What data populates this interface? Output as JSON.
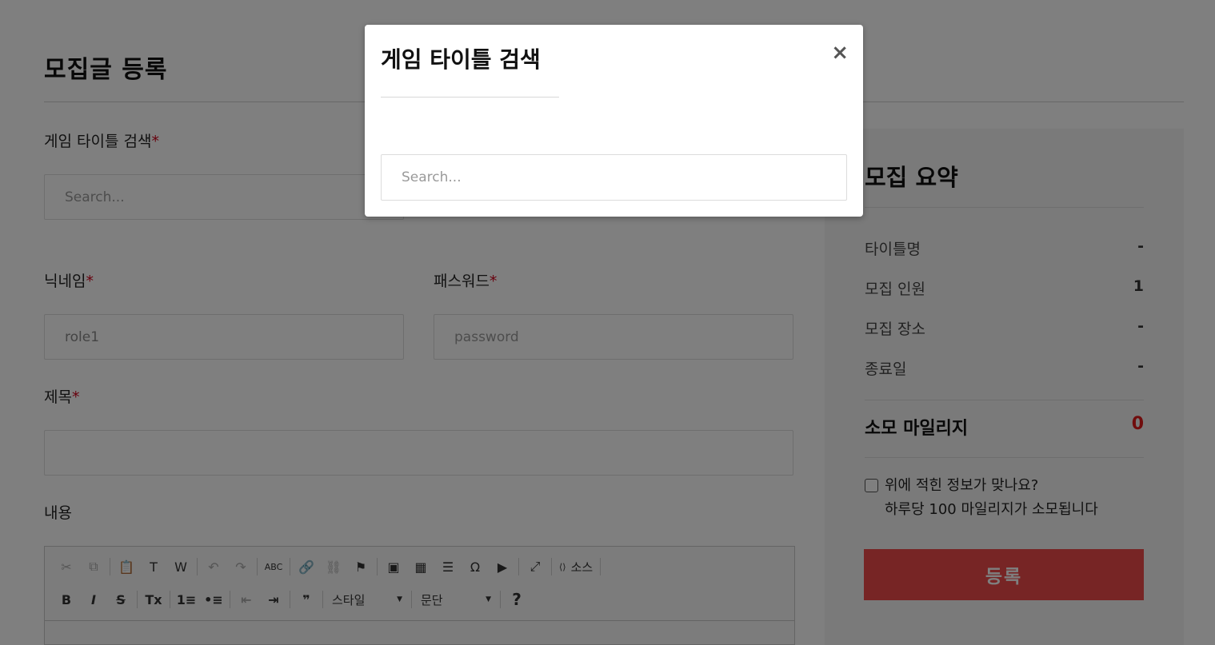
{
  "page": {
    "title": "모집글 등록"
  },
  "form": {
    "required_mark": "*",
    "game_title": {
      "label": "게임 타이틀 검색",
      "placeholder": "Search..."
    },
    "nickname": {
      "label": "닉네임",
      "value": "role1"
    },
    "password": {
      "label": "패스워드",
      "placeholder": "password"
    },
    "subject": {
      "label": "제목",
      "value": ""
    },
    "content": {
      "label": "내용"
    }
  },
  "editor": {
    "toolbar_row1": [
      {
        "icon": "cut-icon",
        "glyph": "✂",
        "enabled": false
      },
      {
        "icon": "copy-icon",
        "glyph": "⧉",
        "enabled": false
      },
      {
        "icon": "paste-icon",
        "glyph": "📋",
        "enabled": true
      },
      {
        "icon": "paste-text-icon",
        "glyph": "T",
        "enabled": true
      },
      {
        "icon": "paste-word-icon",
        "glyph": "W",
        "enabled": true
      },
      {
        "icon": "undo-icon",
        "glyph": "↶",
        "enabled": false
      },
      {
        "icon": "redo-icon",
        "glyph": "↷",
        "enabled": false
      },
      {
        "icon": "spellcheck-icon",
        "glyph": "ABC",
        "enabled": true
      },
      {
        "icon": "link-icon",
        "glyph": "🔗",
        "enabled": true
      },
      {
        "icon": "unlink-icon",
        "glyph": "⛓",
        "enabled": false
      },
      {
        "icon": "anchor-flag-icon",
        "glyph": "⚑",
        "enabled": true
      },
      {
        "icon": "image-icon",
        "glyph": "▣",
        "enabled": true
      },
      {
        "icon": "table-icon",
        "glyph": "▦",
        "enabled": true
      },
      {
        "icon": "horizontal-line-icon",
        "glyph": "☰",
        "enabled": true
      },
      {
        "icon": "special-char-icon",
        "glyph": "Ω",
        "enabled": true
      },
      {
        "icon": "youtube-icon",
        "glyph": "▶",
        "enabled": true
      },
      {
        "icon": "maximize-icon",
        "glyph": "⤢",
        "enabled": true
      }
    ],
    "source_label": "소스",
    "toolbar_row2": [
      {
        "icon": "bold-icon",
        "glyph": "B",
        "enabled": true
      },
      {
        "icon": "italic-icon",
        "glyph": "I",
        "enabled": true
      },
      {
        "icon": "strike-icon",
        "glyph": "S",
        "enabled": true
      },
      {
        "icon": "remove-format-icon",
        "glyph": "Tx",
        "enabled": true
      },
      {
        "icon": "numbered-list-icon",
        "glyph": "1≡",
        "enabled": true
      },
      {
        "icon": "bulleted-list-icon",
        "glyph": "•≡",
        "enabled": true
      },
      {
        "icon": "outdent-icon",
        "glyph": "⇤",
        "enabled": false
      },
      {
        "icon": "indent-icon",
        "glyph": "⇥",
        "enabled": true
      },
      {
        "icon": "blockquote-icon",
        "glyph": "❞",
        "enabled": true
      }
    ],
    "style_combo": "스타일",
    "format_combo": "문단",
    "help_glyph": "?"
  },
  "summary": {
    "title": "모집 요약",
    "rows": [
      {
        "label": "타이틀명",
        "value": "-"
      },
      {
        "label": "모집 인원",
        "value": "1"
      },
      {
        "label": "모집 장소",
        "value": "-"
      },
      {
        "label": "종료일",
        "value": "-"
      }
    ],
    "mileage_label": "소모 마일리지",
    "mileage_value": "0",
    "confirm_line1": "위에 적힌 정보가 맞나요?",
    "confirm_line2": "하루당 100 마일리지가 소모됩니다",
    "submit_label": "등록"
  },
  "modal": {
    "title": "게임 타이틀 검색",
    "close_glyph": "×",
    "search_placeholder": "Search..."
  },
  "colors": {
    "accent": "#ef4b4b",
    "required": "#d0021b",
    "mileage": "#e01a1a"
  }
}
